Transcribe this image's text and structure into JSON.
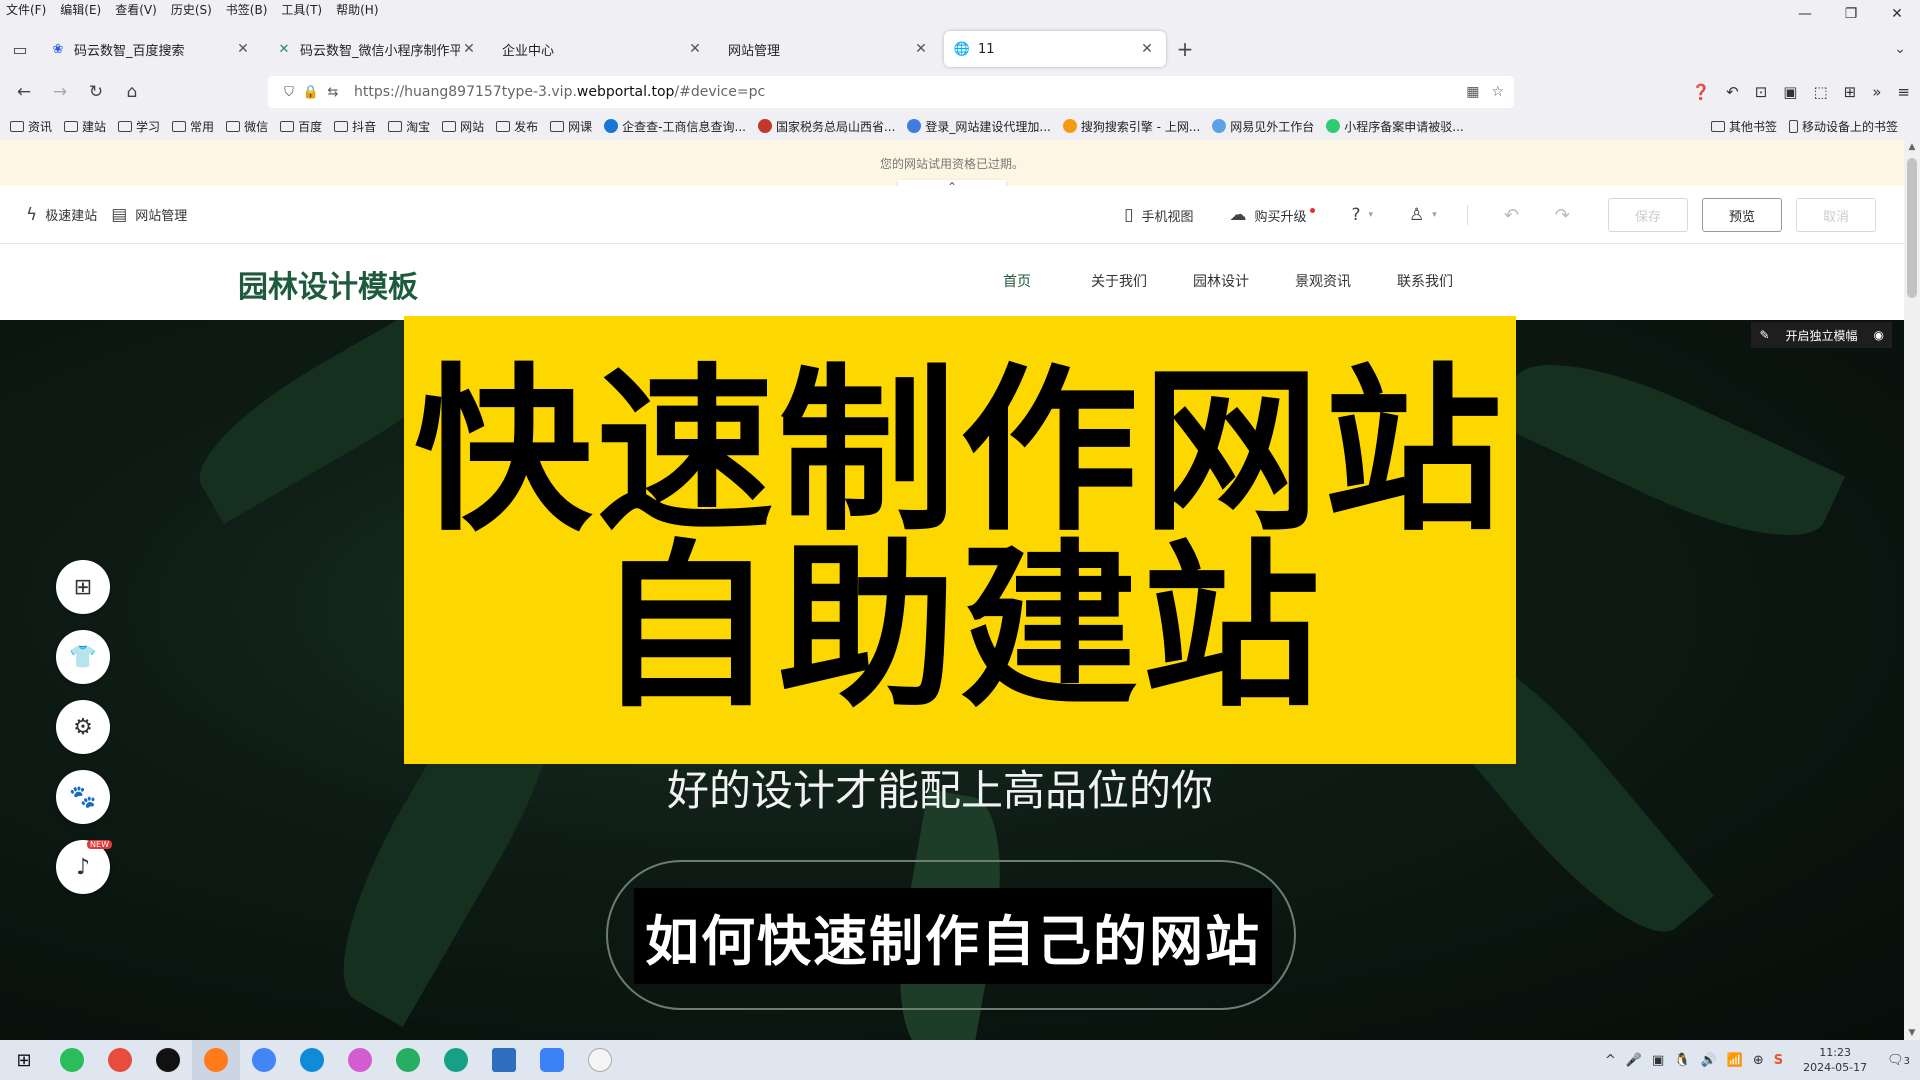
{
  "menubar": [
    "文件(F)",
    "编辑(E)",
    "查看(V)",
    "历史(S)",
    "书签(B)",
    "工具(T)",
    "帮助(H)"
  ],
  "window_controls": {
    "minimize": "—",
    "restore": "❐",
    "close": "✕"
  },
  "tabs": [
    {
      "label": "码云数智_百度搜索",
      "icon": "baidu-icon",
      "glyph": "❀",
      "color": "#2c5de5"
    },
    {
      "label": "码云数智_微信小程序制作平台",
      "icon": "mayun-icon",
      "glyph": "✕",
      "color": "#1f8a5c"
    },
    {
      "label": "企业中心",
      "icon": "",
      "glyph": "",
      "color": "#444444"
    },
    {
      "label": "网站管理",
      "icon": "",
      "glyph": "",
      "color": "#444444"
    },
    {
      "label": "11",
      "icon": "globe-icon",
      "glyph": "🌐",
      "color": "#444444"
    }
  ],
  "tab_close": "✕",
  "new_tab": "+",
  "tab_list": "⌄",
  "nav": {
    "back": "←",
    "forward": "→",
    "reload": "↻",
    "home": "⌂"
  },
  "url": {
    "prefix": "https://huang897157type-3.vip.",
    "domain": "webportal.top",
    "suffix": "/#device=pc"
  },
  "url_icons": {
    "shield": "⛉",
    "lock": "🔒",
    "perm": "⇆",
    "qr": "▦",
    "star": "☆"
  },
  "nav_right": [
    "❓",
    "↶",
    "⊡",
    "▣",
    "⬚",
    "⊞",
    "»",
    "≡"
  ],
  "bookmarks": [
    "资讯",
    "建站",
    "学习",
    "常用",
    "微信",
    "百度",
    "抖音",
    "淘宝",
    "网站",
    "发布",
    "网课"
  ],
  "bookmark_sites": [
    {
      "label": "企查查-工商信息查询...",
      "color": "#1976d2"
    },
    {
      "label": "国家税务总局山西省...",
      "color": "#c0392b"
    },
    {
      "label": "登录_网站建设代理加...",
      "color": "#3f7be0"
    },
    {
      "label": "搜狗搜索引擎 - 上网...",
      "color": "#f39c12"
    },
    {
      "label": "网易见外工作台",
      "color": "#5aa3e8"
    },
    {
      "label": "小程序备案申请被驳...",
      "color": "#2ecc71"
    }
  ],
  "bookmarks_right": [
    "其他书签",
    "移动设备上的书签"
  ],
  "notice": "您的网站试用资格已过期。",
  "collapse_icon": "⌃",
  "editor": {
    "quick": "极速建站",
    "manage": "网站管理",
    "mobile": "手机视图",
    "upgrade": "购买升级",
    "help_icon": "⓪",
    "undo": "↶",
    "redo": "↷",
    "save": "保存",
    "preview": "预览",
    "cancel": "取消"
  },
  "site": {
    "logo": "园林设计模板",
    "nav": [
      "首页",
      "关于我们",
      "园林设计",
      "景观资讯",
      "联系我们"
    ]
  },
  "hero_tools": {
    "edit": "✎",
    "label": "开启独立模幅",
    "eye": "◉"
  },
  "overlay": {
    "line1": "快速制作网站",
    "line2": "自助建站"
  },
  "subtitle": "好的设计才能配上高品位的你",
  "caption": "如何快速制作自己的网站",
  "side_tools": [
    "⊞",
    "👕",
    "⚙",
    "🐾",
    "♪"
  ],
  "new_badge": "NEW",
  "taskbar_apps": [
    {
      "name": "wechat",
      "color": "#2bbd5a"
    },
    {
      "name": "pinwheel",
      "color": "#e74c3c"
    },
    {
      "name": "qq",
      "color": "#111111"
    },
    {
      "name": "firefox",
      "color": "#ff7a18"
    },
    {
      "name": "chrome",
      "color": "#4285f4"
    },
    {
      "name": "edge",
      "color": "#0f8bd8"
    },
    {
      "name": "colorful",
      "color": "#d35cd1"
    },
    {
      "name": "ie-green",
      "color": "#27ae60"
    },
    {
      "name": "ie-green2",
      "color": "#16a085"
    },
    {
      "name": "window",
      "color": "#2f6fc0"
    },
    {
      "name": "feather",
      "color": "#3b82f6"
    },
    {
      "name": "pill",
      "color": "#f5f5f5"
    }
  ],
  "tray": [
    "^",
    "🎤",
    "▣",
    "🐧",
    "🔊",
    "📶",
    "⊕",
    "S"
  ],
  "clock": {
    "time": "11:23",
    "date": "2024-05-17"
  },
  "notification": "🗨",
  "notification_count": "3",
  "colors": {
    "accent": "#1e5a3c",
    "overlay": "#fdd800"
  }
}
